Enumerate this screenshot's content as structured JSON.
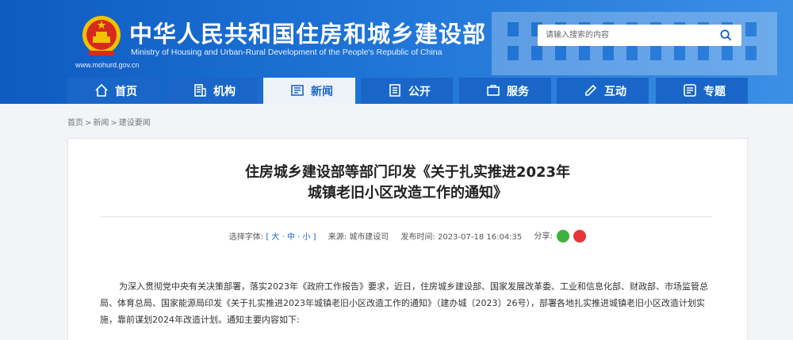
{
  "header": {
    "title": "中华人民共和国住房和城乡建设部",
    "subtitle": "Ministry of Housing and Urban-Rural Development of the People's Republic of China",
    "url": "www.mohurd.gov.cn",
    "colors": {
      "primary": "#1a66c8",
      "gradient_end": "#3b8fe5"
    }
  },
  "search": {
    "placeholder": "请输入搜索的内容"
  },
  "nav": {
    "items": [
      {
        "label": "首页",
        "icon": "home-icon"
      },
      {
        "label": "机构",
        "icon": "building-icon"
      },
      {
        "label": "新闻",
        "icon": "newspaper-icon",
        "active": true
      },
      {
        "label": "公开",
        "icon": "document-icon"
      },
      {
        "label": "服务",
        "icon": "service-icon"
      },
      {
        "label": "互动",
        "icon": "interaction-icon"
      },
      {
        "label": "专题",
        "icon": "topic-icon"
      }
    ]
  },
  "breadcrumb": [
    "首页",
    "新闻",
    "建设要闻"
  ],
  "article": {
    "title_line1": "住房城乡建设部等部门印发《关于扎实推进2023年",
    "title_line2": "城镇老旧小区改造工作的通知》",
    "meta": {
      "font_label": "选择字体:",
      "font_sizes": "[ 大 · 中 · 小 ]",
      "source_label": "来源:",
      "source": "城市建设司",
      "time_label": "发布时间:",
      "time": "2023-07-18 16:04:35",
      "share_label": "分享:"
    },
    "body": "为深入贯彻党中央有关决策部署，落实2023年《政府工作报告》要求，近日，住房城乡建设部、国家发展改革委、工业和信息化部、财政部、市场监管总局、体育总局、国家能源局印发《关于扎实推进2023年城镇老旧小区改造工作的通知》（建办城〔2023〕26号），部署各地扎实推进城镇老旧小区改造计划实施，靠前谋划2024年改造计划。通知主要内容如下:"
  }
}
